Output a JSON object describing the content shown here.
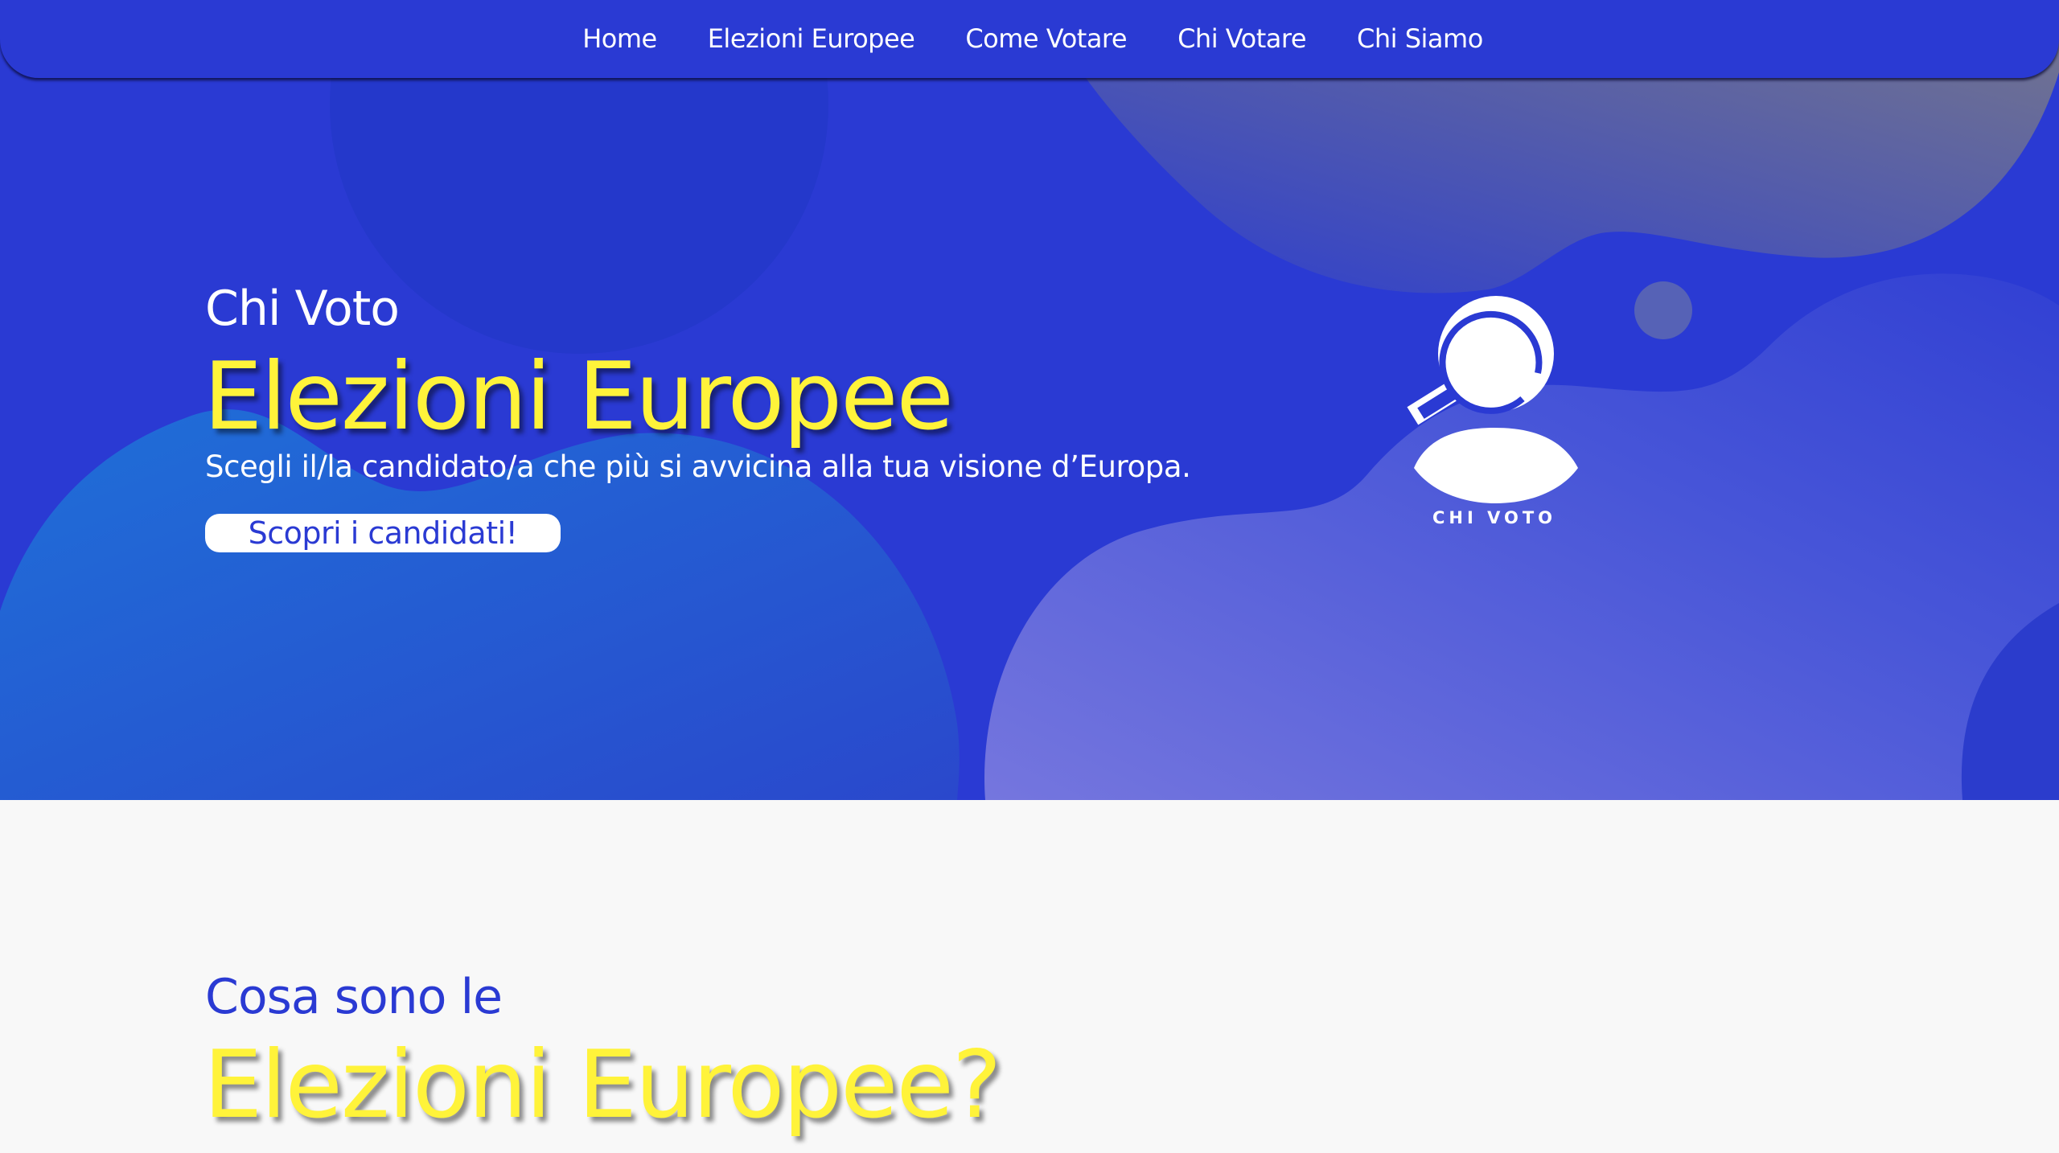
{
  "nav": {
    "items": [
      {
        "label": "Home"
      },
      {
        "label": "Elezioni Europee"
      },
      {
        "label": "Come Votare"
      },
      {
        "label": "Chi Votare"
      },
      {
        "label": "Chi Siamo"
      }
    ]
  },
  "hero": {
    "kicker": "Chi Voto",
    "title": "Elezioni Europee",
    "subtitle": "Scegli il/la candidato/a che più si avvicina alla tua visione d’Europa.",
    "cta_label": "Scopri i candidati!",
    "logo_icon": "user-magnifier-icon",
    "logo_caption": "CHI VOTO"
  },
  "section2": {
    "kicker": "Cosa sono le",
    "title": "Elezioni Europee?"
  },
  "colors": {
    "primary_blue": "#2a3ad3",
    "accent_yellow": "#fff33a",
    "page_background": "#f8f8f8",
    "text_white": "#ffffff"
  }
}
